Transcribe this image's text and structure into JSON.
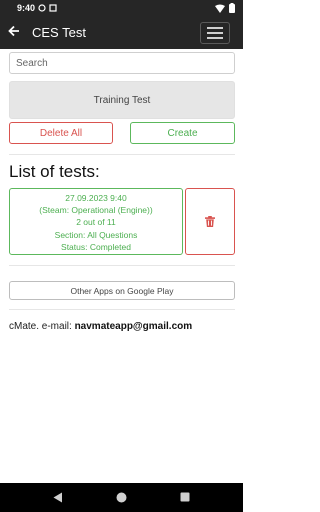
{
  "status_bar": {
    "time": "9:40",
    "icons": [
      "notification-a-icon",
      "notification-b-icon",
      "wifi-icon",
      "battery-icon"
    ]
  },
  "app_bar": {
    "title": "CES Test",
    "back_icon": "arrow-back-icon",
    "menu_icon": "hamburger-menu-icon"
  },
  "search": {
    "placeholder": "Search",
    "value": ""
  },
  "training_button": {
    "label": "Training Test"
  },
  "actions": {
    "delete_label": "Delete All",
    "create_label": "Create"
  },
  "list": {
    "heading": "List of tests:",
    "items": [
      {
        "date": "27.09.2023 9:40",
        "type": "(Steam: Operational (Engine))",
        "progress": "2 out of 11",
        "section": "Section: All Questions",
        "status": "Status: Completed"
      }
    ]
  },
  "other_apps": {
    "label": "Other Apps on Google Play"
  },
  "contact": {
    "prefix": "cMate. e-mail: ",
    "email": "navmateapp@gmail.com"
  },
  "nav_bar": {
    "icons": [
      "back-triangle-icon",
      "home-circle-icon",
      "recents-square-icon"
    ]
  },
  "colors": {
    "appbar": "#262626",
    "danger": "#d9534f",
    "success": "#4caf50",
    "training_bg": "#e6e6e6"
  }
}
